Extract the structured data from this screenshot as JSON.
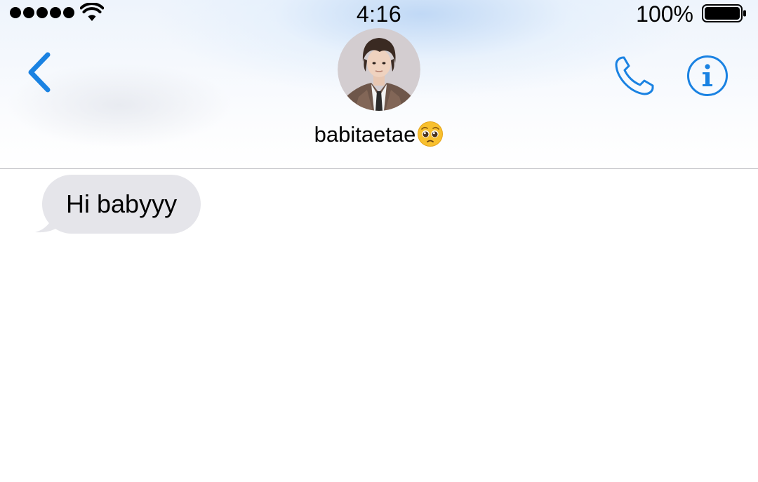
{
  "status_bar": {
    "time": "4:16",
    "battery_percent": "100%",
    "signal_bars": 5,
    "icons": [
      "signal-dots-icon",
      "wifi-icon",
      "battery-icon"
    ]
  },
  "nav": {
    "back_icon": "chevron-left-icon",
    "contact_name": "babitaetae",
    "name_emoji_icon": "pleading-face-emoji-icon",
    "avatar_icon": "contact-avatar-photo",
    "call_icon": "phone-icon",
    "info_icon": "info-icon"
  },
  "conversation": {
    "messages": [
      {
        "direction": "incoming",
        "text": "Hi babyyy"
      }
    ]
  },
  "colors": {
    "accent": "#1a82e2",
    "incoming_bubble": "#e5e5ea",
    "divider": "#bdbdc2"
  }
}
